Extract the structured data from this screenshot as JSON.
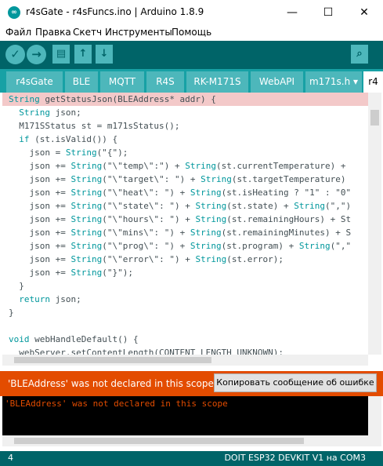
{
  "window": {
    "title": "r4sGate - r4sFuncs.ino | Arduino 1.8.9",
    "icon_text": "∞",
    "minimize": "—",
    "maximize": "☐",
    "close": "✕"
  },
  "menu": [
    "Файл",
    "Правка",
    "Скетч",
    "Инструменты",
    "Помощь"
  ],
  "toolbar": {
    "verify": "✓",
    "upload": "→",
    "new": "▤",
    "open": "↑",
    "save": "↓",
    "serial_monitor": "⌕"
  },
  "tabs": [
    "r4sGate",
    "BLE",
    "MQTT",
    "R4S",
    "RK-M171S",
    "WebAPI",
    "m171s.h ▾",
    "r4"
  ],
  "editor": {
    "lines": [
      "String getStatusJson(BLEAddress* addr) {",
      "  String json;",
      "  M171SStatus st = m171sStatus();",
      "  if (st.isValid()) {",
      "    json = String(\"{\");",
      "    json += String(\"\\\"temp\\\":\") + String(st.currentTemperature) +",
      "    json += String(\"\\\"target\\\": \") + String(st.targetTemperature)",
      "    json += String(\"\\\"heat\\\": \") + String(st.isHeating ? \"1\" : \"0\"",
      "    json += String(\"\\\"state\\\": \") + String(st.state) + String(\",\")",
      "    json += String(\"\\\"hours\\\": \") + String(st.remainingHours) + St",
      "    json += String(\"\\\"mins\\\": \") + String(st.remainingMinutes) + S",
      "    json += String(\"\\\"prog\\\": \") + String(st.program) + String(\",\"",
      "    json += String(\"\\\"error\\\": \") + String(st.error);",
      "    json += String(\"}\");",
      "  }",
      "  return json;",
      "}",
      "",
      "void webHandleDefault() {",
      "  webServer.setContentLength(CONTENT_LENGTH_UNKNOWN);"
    ]
  },
  "status": {
    "message": "'BLEAddress' was not declared in this scope",
    "copy_button": "Копировать сообщение об ошибке"
  },
  "console": {
    "text": "'BLEAddress' was not declared in this scope"
  },
  "footer": {
    "line": "4",
    "board": "DOIT ESP32 DEVKIT V1 на COM3"
  },
  "colors": {
    "toolbar": "#006468",
    "tabbar": "#17a1a5",
    "error": "#e34c00",
    "highlight_line": "#f3c9c9"
  }
}
